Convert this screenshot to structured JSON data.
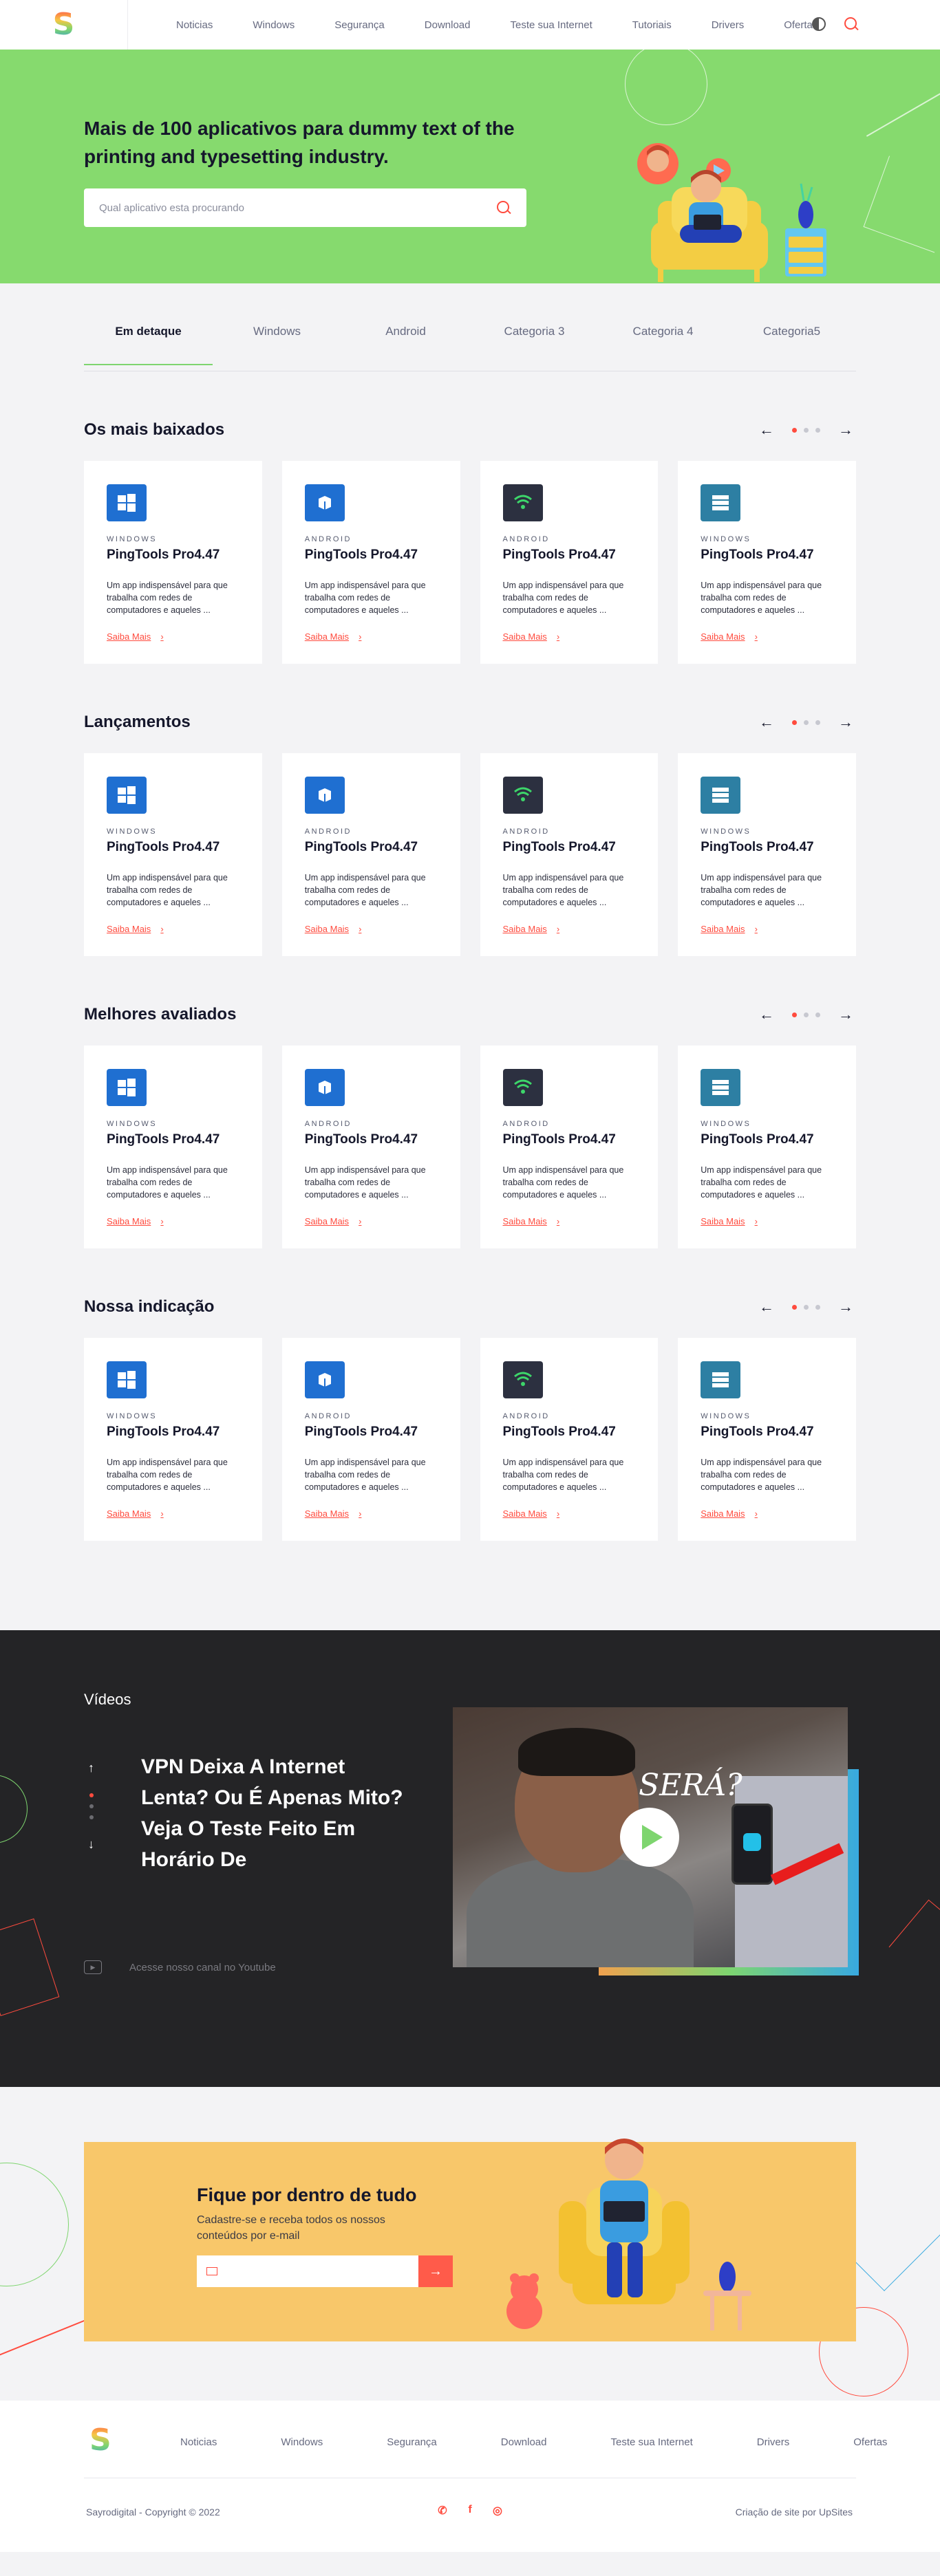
{
  "header": {
    "logo": "S",
    "nav": [
      "Noticias",
      "Windows",
      "Segurança",
      "Download",
      "Teste sua Internet",
      "Tutoriais",
      "Drivers",
      "Ofertas"
    ]
  },
  "hero": {
    "title": "Mais de 100 aplicativos para dummy text of the printing and typesetting industry.",
    "search_placeholder": "Qual aplicativo esta procurando"
  },
  "tabs": [
    "Em detaque",
    "Windows",
    "Android",
    "Categoria 3",
    "Categoria 4",
    "Categoria5"
  ],
  "card_template": {
    "title": "PingTools Pro4.47",
    "description": "Um app indispensável para que trabalha com redes de computadores e aqueles ...",
    "more": "Saiba Mais"
  },
  "sections": [
    {
      "title": "Os mais baixados"
    },
    {
      "title": "Lançamentos"
    },
    {
      "title": "Melhores avaliados"
    },
    {
      "title": "Nossa indicação"
    }
  ],
  "card_platforms": [
    "WINDOWS",
    "ANDROID",
    "ANDROID",
    "WINDOWS"
  ],
  "videos": {
    "label": "Vídeos",
    "title": "VPN Deixa A Internet Lenta? Ou É Apenas Mito? Veja O Teste Feito Em Horário De",
    "thumbnail_text": "SERÁ?",
    "youtube_link": "Acesse nosso canal no Youtube"
  },
  "newsletter": {
    "title": "Fique por dentro de tudo",
    "subtitle": "Cadastre-se e receba todos os nossos conteúdos por e-mail",
    "email_placeholder": "",
    "submit": "→"
  },
  "footer": {
    "nav": [
      "Noticias",
      "Windows",
      "Segurança",
      "Download",
      "Teste sua Internet",
      "Drivers",
      "Ofertas"
    ],
    "copyright": "Sayrodigital - Copyright © 2022",
    "credit": "Criação de site por UpSites"
  },
  "colors": {
    "accent": "#ff4b3e",
    "green": "#86da6e",
    "yellow": "#f8c76a",
    "dark": "#242426"
  }
}
